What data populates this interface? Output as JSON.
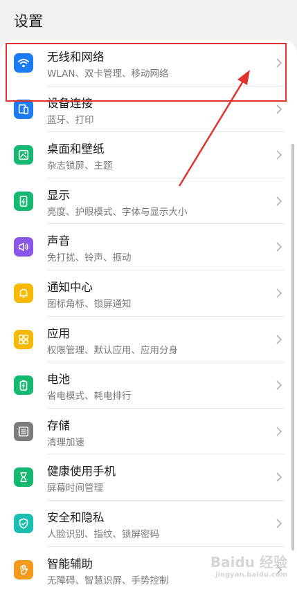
{
  "header": {
    "title": "设置"
  },
  "items": [
    {
      "label": "无线和网络",
      "sub": "WLAN、双卡管理、移动网络",
      "icon": "wifi-icon",
      "color": "#1a7bf5"
    },
    {
      "label": "设备连接",
      "sub": "蓝牙、打印",
      "icon": "device-connect-icon",
      "color": "#1a7bf5"
    },
    {
      "label": "桌面和壁纸",
      "sub": "杂志锁屏、主题",
      "icon": "wallpaper-icon",
      "color": "#15b870"
    },
    {
      "label": "显示",
      "sub": "亮度、护眼模式、字体与显示大小",
      "icon": "display-icon",
      "color": "#15b870"
    },
    {
      "label": "声音",
      "sub": "免打扰、铃声、振动",
      "icon": "sound-icon",
      "color": "#8a56e8"
    },
    {
      "label": "通知中心",
      "sub": "图标角标、锁屏通知",
      "icon": "bell-icon",
      "color": "#f7b900"
    },
    {
      "label": "应用",
      "sub": "权限管理、默认应用、应用分身",
      "icon": "apps-icon",
      "color": "#f7b900"
    },
    {
      "label": "电池",
      "sub": "省电模式、耗电排行",
      "icon": "battery-icon",
      "color": "#15b870"
    },
    {
      "label": "存储",
      "sub": "清理加速",
      "icon": "storage-icon",
      "color": "#7d7d7d"
    },
    {
      "label": "健康使用手机",
      "sub": "屏幕时间管理",
      "icon": "hourglass-icon",
      "color": "#15b870"
    },
    {
      "label": "安全和隐私",
      "sub": "人脸识别、指纹、锁屏密码",
      "icon": "shield-icon",
      "color": "#1abfb0"
    },
    {
      "label": "智能辅助",
      "sub": "无障碍、智慧识屏、手势控制",
      "icon": "hand-icon",
      "color": "#f39a1e"
    }
  ],
  "watermark": {
    "text": "Baidu 经验",
    "sub": "jingyan.baidu.com"
  }
}
